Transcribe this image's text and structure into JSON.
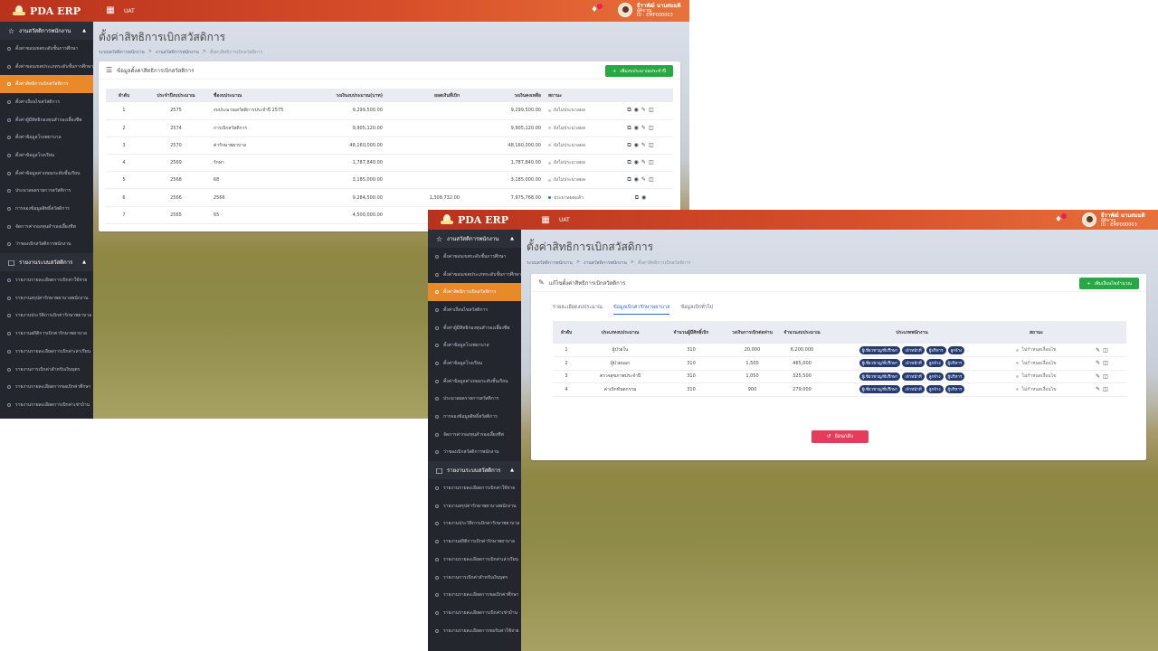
{
  "app": {
    "brand": "PDA ERP",
    "env": "UAT"
  },
  "user": {
    "name": "ธีราพัฒ์ นามสมมติ",
    "role": "ผู้ดิจาญ",
    "id": "ID : EMP000003"
  },
  "sidebar": {
    "group1": "งานสวัสดิการพนักงาน",
    "items": [
      "ตั้งค่าขอบเขตระดับชั้นการศึกษา",
      "ตั้งค่าขอบเขตประเภทระดับชั้นการศึกษา",
      "ตั้งค่าสิทธิการเบิกสวัสดิการ",
      "ตั้งค่าเงื่อนไขสวัสดิการ",
      "ตั้งค่าผู้มีสิทธิกองทุนสำรองเลี้ยงชีพ",
      "ตั้งค่าข้อมูลโรงพยาบาล",
      "ตั้งค่าข้อมูลโรงเรียน",
      "ตั้งค่าข้อมูลค่าเทอมระดับชั้นเรียน",
      "ประมวลผลรายการสวัสดิการ",
      "การจองข้อมูลสิทธิ์สวัสดิการ",
      "จัดการค่ากองทุนสำรองเลี้ยงชีพ",
      "ว่าของเบิกสวัสดิการพนักงาน"
    ],
    "group2": "รายงานระบบสวัสดิการ",
    "reports": [
      "รายงานรายละเอียดการเบิกค่าใช้จ่าย",
      "รายงานสรุปค่ารักษาพยาบาลพนักงาน",
      "รายงานประวัติการเบิกค่ารักษาพยาบาล",
      "รายงานสถิติการเบิกค่ารักษาพยาบาล",
      "รายงานรายละเอียดการเบิกค่าเล่าเรียน",
      "รายงานการเบิกค่าสำหรับเงินบุตร",
      "รายงานรายละเอียดการขอเบิกค่าศึกษา",
      "รายงานรายละเอียดการเบิกค่าเช่าบ้าน",
      "รายงานรายละเอียดการขอรับค่าใช้จ่าย"
    ]
  },
  "page": {
    "title": "ตั้งค่าสิทธิการเบิกสวัสดิการ",
    "breadcrumb": [
      "ระบบสวัสดิการพนักงาน",
      "งานสวัสดิการพนักงาน",
      "ตั้งค่าสิทธิการเบิกสวัสดิการ"
    ]
  },
  "list": {
    "header": "ข้อมูลตั้งค่าสิทธิการเบิกสวัสดิการ",
    "add_label": "เพิ่มงบประมาณประจำปี",
    "columns": [
      "ลำดับ",
      "ประจำปีงบประมาณ",
      "ชื่องบประมาณ",
      "วงเงินงบประมาณ(บาท)",
      "ยอดเงินที่เบิก",
      "วงเงินคงเหลือ",
      "สถานะ",
      ""
    ],
    "rows": [
      {
        "no": "1",
        "year": "2575",
        "name": "งบประมาณสวัสดิการประจำปี 2575",
        "budget": "9,299,500.00",
        "used": "",
        "remain": "9,299,500.00",
        "status": "ยังไม่ประมวลผล"
      },
      {
        "no": "2",
        "year": "2574",
        "name": "การเบิกสวัสดิการ",
        "budget": "9,905,120.00",
        "used": "",
        "remain": "9,905,120.00",
        "status": "ยังไม่ประมวลผล"
      },
      {
        "no": "3",
        "year": "2570",
        "name": "ค่ารักษาพยาบาล",
        "budget": "48,160,000.00",
        "used": "",
        "remain": "48,160,000.00",
        "status": "ยังไม่ประมวลผล"
      },
      {
        "no": "4",
        "year": "2569",
        "name": "รักษา",
        "budget": "1,787,840.00",
        "used": "",
        "remain": "1,787,840.00",
        "status": "ยังไม่ประมวลผล"
      },
      {
        "no": "5",
        "year": "2568",
        "name": "68",
        "budget": "3,185,000.00",
        "used": "",
        "remain": "3,185,000.00",
        "status": "ยังไม่ประมวลผล"
      },
      {
        "no": "6",
        "year": "2566",
        "name": "2566",
        "budget": "9,284,500.00",
        "used": "1,308,732.00",
        "remain": "7,975,768.00",
        "status": "ประมวลผลแล้ว"
      },
      {
        "no": "7",
        "year": "2565",
        "name": "65",
        "budget": "4,500,000.00",
        "used": "",
        "remain": "",
        "status": ""
      }
    ]
  },
  "edit": {
    "header": "แก้ไขตั้งค่าสิทธิการเบิกสวัสดิการ",
    "add_label": "เพิ่มเงื่อนไขจำนวณ",
    "tabs": [
      "รายละเอียดงบประมาณ",
      "ข้อมูลเบิกค่ารักษาพยาบาล",
      "ข้อมูลเบิกทั่วไป"
    ],
    "columns": [
      "ลำดับ",
      "ประเภทงบประมาณ",
      "จำนวนผู้มีสิทธิ์เบิก",
      "วงเงินการเบิกต่อท่าน",
      "จำนวนงบประมาณ",
      "ประเภทพนักงาน",
      "สถานะ",
      ""
    ],
    "rows": [
      {
        "no": "1",
        "type": "ผู้ป่วยใน",
        "people": "310",
        "limit": "20,000",
        "total": "6,200,000",
        "chips": [
          "ผู้เชี่ยวชาญ/ที่ปรึกษา",
          "เจ้าหน้าที่",
          "ผู้บริหาร",
          "ลูกจ้าง"
        ],
        "status": "ไม่กำหนดเงื่อนไข"
      },
      {
        "no": "2",
        "type": "ผู้ป่วยนอก",
        "people": "310",
        "limit": "1,500",
        "total": "465,000",
        "chips": [
          "ผู้เชี่ยวชาญ/ที่ปรึกษา",
          "เจ้าหน้าที่",
          "ลูกจ้าง",
          "ผู้บริหาร"
        ],
        "status": "ไม่กำหนดเงื่อนไข"
      },
      {
        "no": "3",
        "type": "ตรวจสุขภาพประจำปี",
        "people": "310",
        "limit": "1,050",
        "total": "325,500",
        "chips": [
          "ผู้เชี่ยวชาญ/ที่ปรึกษา",
          "เจ้าหน้าที่",
          "ลูกจ้าง",
          "ผู้บริหาร"
        ],
        "status": "ไม่กำหนดเงื่อนไข"
      },
      {
        "no": "4",
        "type": "ค่าเบิกทันตกรรม",
        "people": "310",
        "limit": "900",
        "total": "279,000",
        "chips": [
          "ผู้เชี่ยวชาญ/ที่ปรึกษา",
          "เจ้าหน้าที่",
          "ลูกจ้าง",
          "ผู้บริหาร"
        ],
        "status": "ไม่กำหนดเงื่อนไข"
      }
    ],
    "back_label": "ย้อนกลับ"
  }
}
